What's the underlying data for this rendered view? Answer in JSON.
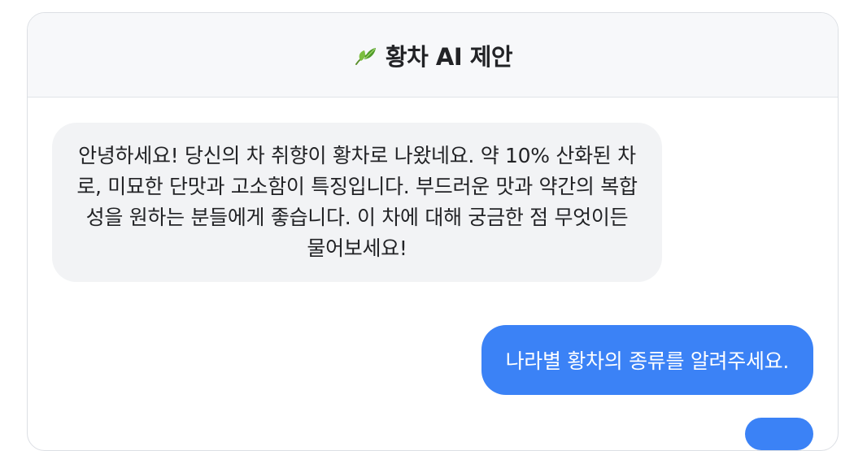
{
  "header": {
    "icon": "leaf-icon",
    "title": "황차 AI 제안"
  },
  "messages": [
    {
      "role": "assistant",
      "text": "안녕하세요! 당신의 차 취향이 황차로 나왔네요. 약 10% 산화된 차로, 미묘한 단맛과 고소함이 특징입니다. 부드러운 맛과 약간의 복합성을 원하는 분들에게 좋습니다. 이 차에 대해 궁금한 점 무엇이든 물어보세요!"
    },
    {
      "role": "user",
      "text": "나라별 황차의 종류를 알려주세요."
    }
  ],
  "colors": {
    "user_bubble": "#3b82f6",
    "assistant_bubble": "#f2f3f5",
    "header_bg": "#f7f8fa"
  }
}
